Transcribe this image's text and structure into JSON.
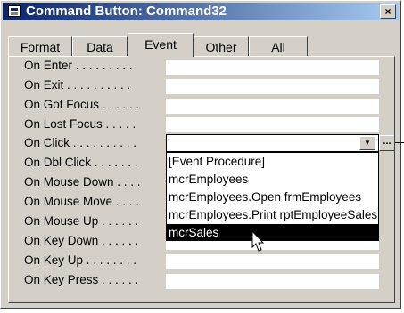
{
  "window": {
    "title": "Command Button: Command32",
    "close_label": "×"
  },
  "tabs": [
    {
      "label": "Format",
      "active": false
    },
    {
      "label": "Data",
      "active": false
    },
    {
      "label": "Event",
      "active": true
    },
    {
      "label": "Other",
      "active": false
    },
    {
      "label": "All",
      "active": false
    }
  ],
  "properties": [
    {
      "label": "On Enter . . . . . . . . .",
      "value": ""
    },
    {
      "label": "On Exit . . . . . . . . . .",
      "value": ""
    },
    {
      "label": "On Got Focus . . . . . .",
      "value": ""
    },
    {
      "label": "On Lost Focus . . . . .",
      "value": ""
    },
    {
      "label": "On Click . . . . . . . . . .",
      "value": ""
    },
    {
      "label": "On Dbl Click . . . . . . .",
      "value": ""
    },
    {
      "label": "On Mouse Down . . . .",
      "value": ""
    },
    {
      "label": "On Mouse Move . . . .",
      "value": ""
    },
    {
      "label": "On Mouse Up . . . . . .",
      "value": ""
    },
    {
      "label": "On Key Down . . . . . .",
      "value": ""
    },
    {
      "label": "On Key Up . . . . . . . .",
      "value": ""
    },
    {
      "label": "On Key Press . . . . . .",
      "value": ""
    }
  ],
  "dropdown": {
    "drop_button": "▼",
    "build_button": "...",
    "options": [
      "[Event Procedure]",
      "mcrEmployees",
      "mcrEmployees.Open frmEmployees",
      "mcrEmployees.Print rptEmployeeSales",
      "mcrSales"
    ],
    "selected": "mcrSales"
  }
}
